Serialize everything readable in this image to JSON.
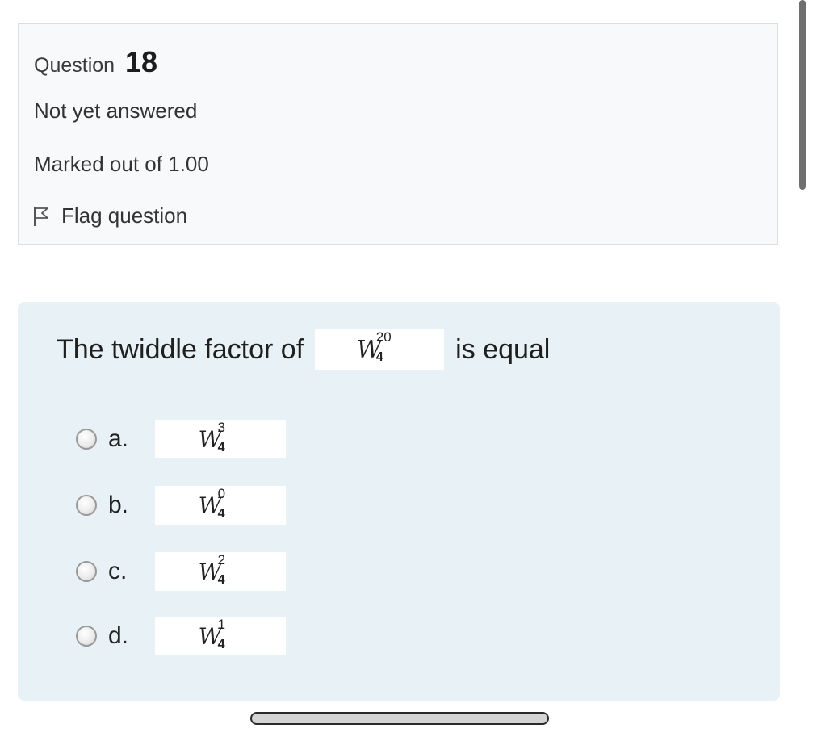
{
  "info": {
    "question_label": "Question",
    "question_number": "18",
    "state": "Not yet answered",
    "grade": "Marked out of 1.00",
    "flag_label": "Flag question",
    "flag_icon": "flag-outline-icon"
  },
  "question": {
    "text_before": "The twiddle factor of",
    "text_after": "is equal",
    "formula": {
      "base": "W",
      "sub": "4",
      "sup": "20"
    }
  },
  "options": [
    {
      "letter": "a.",
      "base": "W",
      "sub": "4",
      "sup": "3"
    },
    {
      "letter": "b.",
      "base": "W",
      "sub": "4",
      "sup": "0"
    },
    {
      "letter": "c.",
      "base": "W",
      "sub": "4",
      "sup": "2"
    },
    {
      "letter": "d.",
      "base": "W",
      "sub": "4",
      "sup": "1"
    }
  ],
  "colors": {
    "info_background": "#f8f9fa",
    "formulation_background": "#e7f1f6"
  }
}
